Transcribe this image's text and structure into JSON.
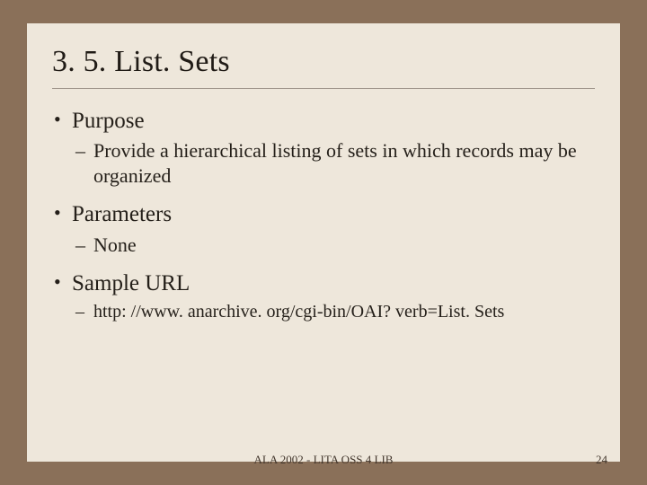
{
  "title": "3. 5. List. Sets",
  "bullets": [
    {
      "label": "Purpose",
      "subs": [
        "Provide a hierarchical listing of sets in which records may be organized"
      ]
    },
    {
      "label": "Parameters",
      "subs": [
        "None"
      ]
    },
    {
      "label": "Sample URL",
      "subs": [
        "http: //www. anarchive. org/cgi-bin/OAI? verb=List. Sets"
      ]
    }
  ],
  "footer_center": "ALA 2002 - LITA OSS 4 LIB",
  "footer_page": "24"
}
